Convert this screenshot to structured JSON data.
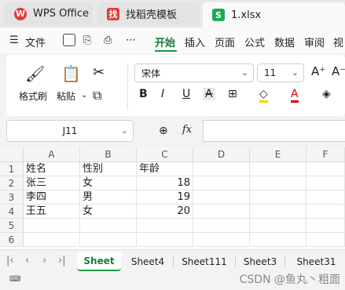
{
  "tabs": [
    {
      "label": "WPS Office",
      "icon": "wps-logo-icon"
    },
    {
      "label": "找稻壳模板",
      "icon": "daoke-logo-icon"
    },
    {
      "label": "1.xlsx",
      "icon": "spreadsheet-icon"
    }
  ],
  "menu": {
    "file": "文件",
    "items": [
      "开始",
      "插入",
      "页面",
      "公式",
      "数据",
      "审阅",
      "视"
    ],
    "active": "开始"
  },
  "ribbon": {
    "format_painter": "格式刷",
    "paste": "粘贴",
    "font": "宋体",
    "font_size": "11"
  },
  "formula": {
    "cell_ref": "J11",
    "fx": "fx",
    "value": ""
  },
  "grid": {
    "columns": [
      "A",
      "B",
      "C",
      "D",
      "E",
      "F"
    ],
    "rows": [
      "1",
      "2",
      "3",
      "4",
      "5",
      "6"
    ],
    "cells": [
      [
        "姓名",
        "性别",
        "年龄",
        "",
        "",
        ""
      ],
      [
        "张三",
        "女",
        "18",
        "",
        "",
        ""
      ],
      [
        "李四",
        "男",
        "19",
        "",
        "",
        ""
      ],
      [
        "王五",
        "女",
        "20",
        "",
        "",
        ""
      ],
      [
        "",
        "",
        "",
        "",
        "",
        ""
      ],
      [
        "",
        "",
        "",
        "",
        "",
        ""
      ]
    ]
  },
  "sheets": [
    "Sheet",
    "Sheet4",
    "Sheet111",
    "Sheet3",
    "Sheet31"
  ],
  "active_sheet": "Sheet",
  "watermark": "CSDN @鱼丸丶粗面"
}
